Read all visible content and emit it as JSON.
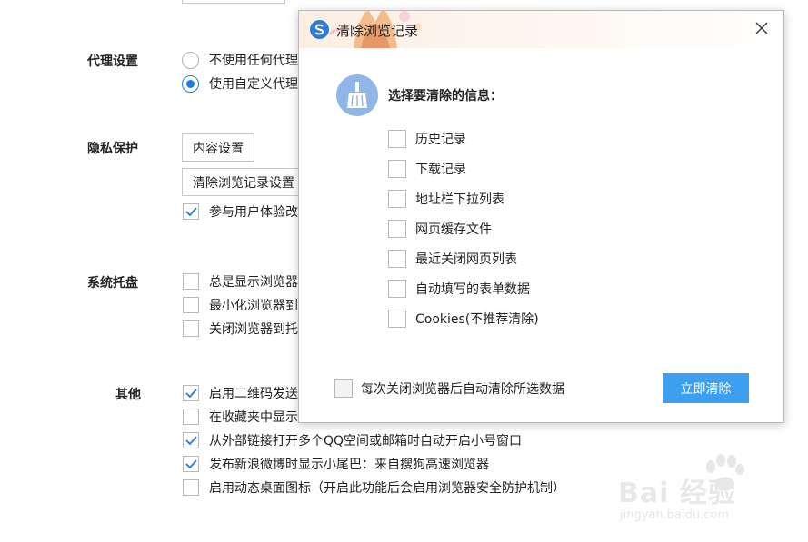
{
  "settings": {
    "proxy": {
      "label": "代理设置",
      "options": [
        {
          "label": "不使用任何代理",
          "selected": false
        },
        {
          "label": "使用自定义代理",
          "selected": true
        }
      ]
    },
    "privacy": {
      "label": "隐私保护",
      "content_settings_button": "内容设置",
      "clear_history_settings_button": "清除浏览记录设置",
      "ux_checkbox": {
        "label": "参与用户体验改",
        "checked": true
      }
    },
    "tray": {
      "label": "系统托盘",
      "items": [
        {
          "label": "总是显示浏览器",
          "checked": false
        },
        {
          "label": "最小化浏览器到",
          "checked": false
        },
        {
          "label": "关闭浏览器到托",
          "checked": false
        }
      ]
    },
    "other": {
      "label": "其他",
      "items": [
        {
          "label": "启用二维码发送",
          "checked": true
        },
        {
          "label": "在收藏夹中显示",
          "checked": false
        },
        {
          "label": "从外部链接打开多个QQ空间或邮箱时自动开启小号窗口",
          "checked": true
        },
        {
          "label": "发布新浪微博时显示小尾巴：来自搜狗高速浏览器",
          "checked": true
        },
        {
          "label": "启用动态桌面图标（开启此功能后会启用浏览器安全防护机制）",
          "checked": false
        }
      ]
    }
  },
  "dialog": {
    "title": "清除浏览记录",
    "heading": "选择要清除的信息：",
    "options": [
      {
        "label": "历史记录",
        "checked": false
      },
      {
        "label": "下载记录",
        "checked": false
      },
      {
        "label": "地址栏下拉列表",
        "checked": false
      },
      {
        "label": "网页缓存文件",
        "checked": false
      },
      {
        "label": "最近关闭网页列表",
        "checked": false
      },
      {
        "label": "自动填写的表单数据",
        "checked": false
      },
      {
        "label": "Cookies(不推荐清除)",
        "checked": false
      }
    ],
    "auto_clear": {
      "label": "每次关闭浏览器后自动清除所选数据",
      "checked": false
    },
    "clear_button": "立即清除",
    "icons": {
      "logo": "sogou-browser-logo-icon",
      "close": "close-icon",
      "broom": "broom-icon"
    },
    "colors": {
      "accent": "#3c9ff0",
      "broom_bg": "#8fb6e6",
      "radio_on": "#1c7ee0"
    }
  },
  "watermark": {
    "brand": "Bai 经验",
    "url": "jingyan.baidu.com"
  }
}
